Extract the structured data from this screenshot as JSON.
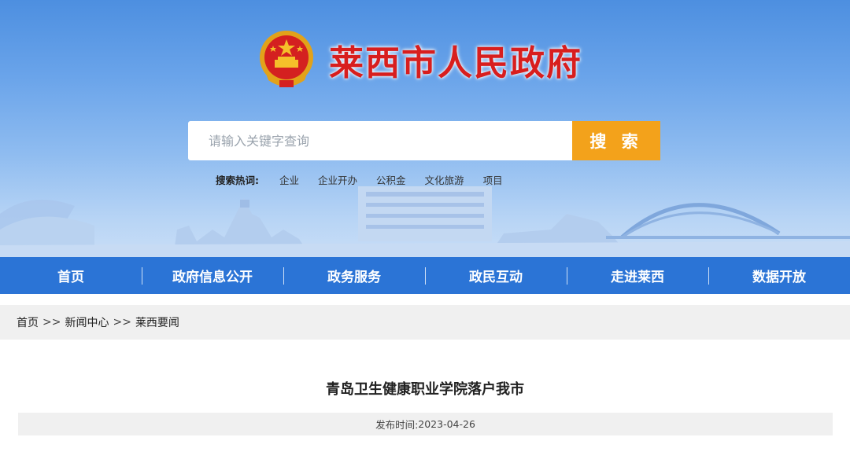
{
  "header": {
    "site_title": "莱西市人民政府",
    "emblem_icon": "national-emblem-icon"
  },
  "search": {
    "placeholder": "请输入关键字查询",
    "button_label": "搜 索",
    "hot_label": "搜索热词:",
    "hot_words": [
      "企业",
      "企业开办",
      "公积金",
      "文化旅游",
      "项目"
    ]
  },
  "nav": {
    "items": [
      "首页",
      "政府信息公开",
      "政务服务",
      "政民互动",
      "走进莱西",
      "数据开放"
    ]
  },
  "breadcrumb": {
    "items": [
      "首页",
      "新闻中心",
      "莱西要闻"
    ],
    "separator": ">>"
  },
  "article": {
    "title": "青岛卫生健康职业学院落户我市",
    "publish_label": "发布时间:",
    "publish_date": "2023-04-26"
  },
  "colors": {
    "title_red": "#d81e1e",
    "search_orange": "#f3a21b",
    "nav_blue": "#2b74d6"
  }
}
